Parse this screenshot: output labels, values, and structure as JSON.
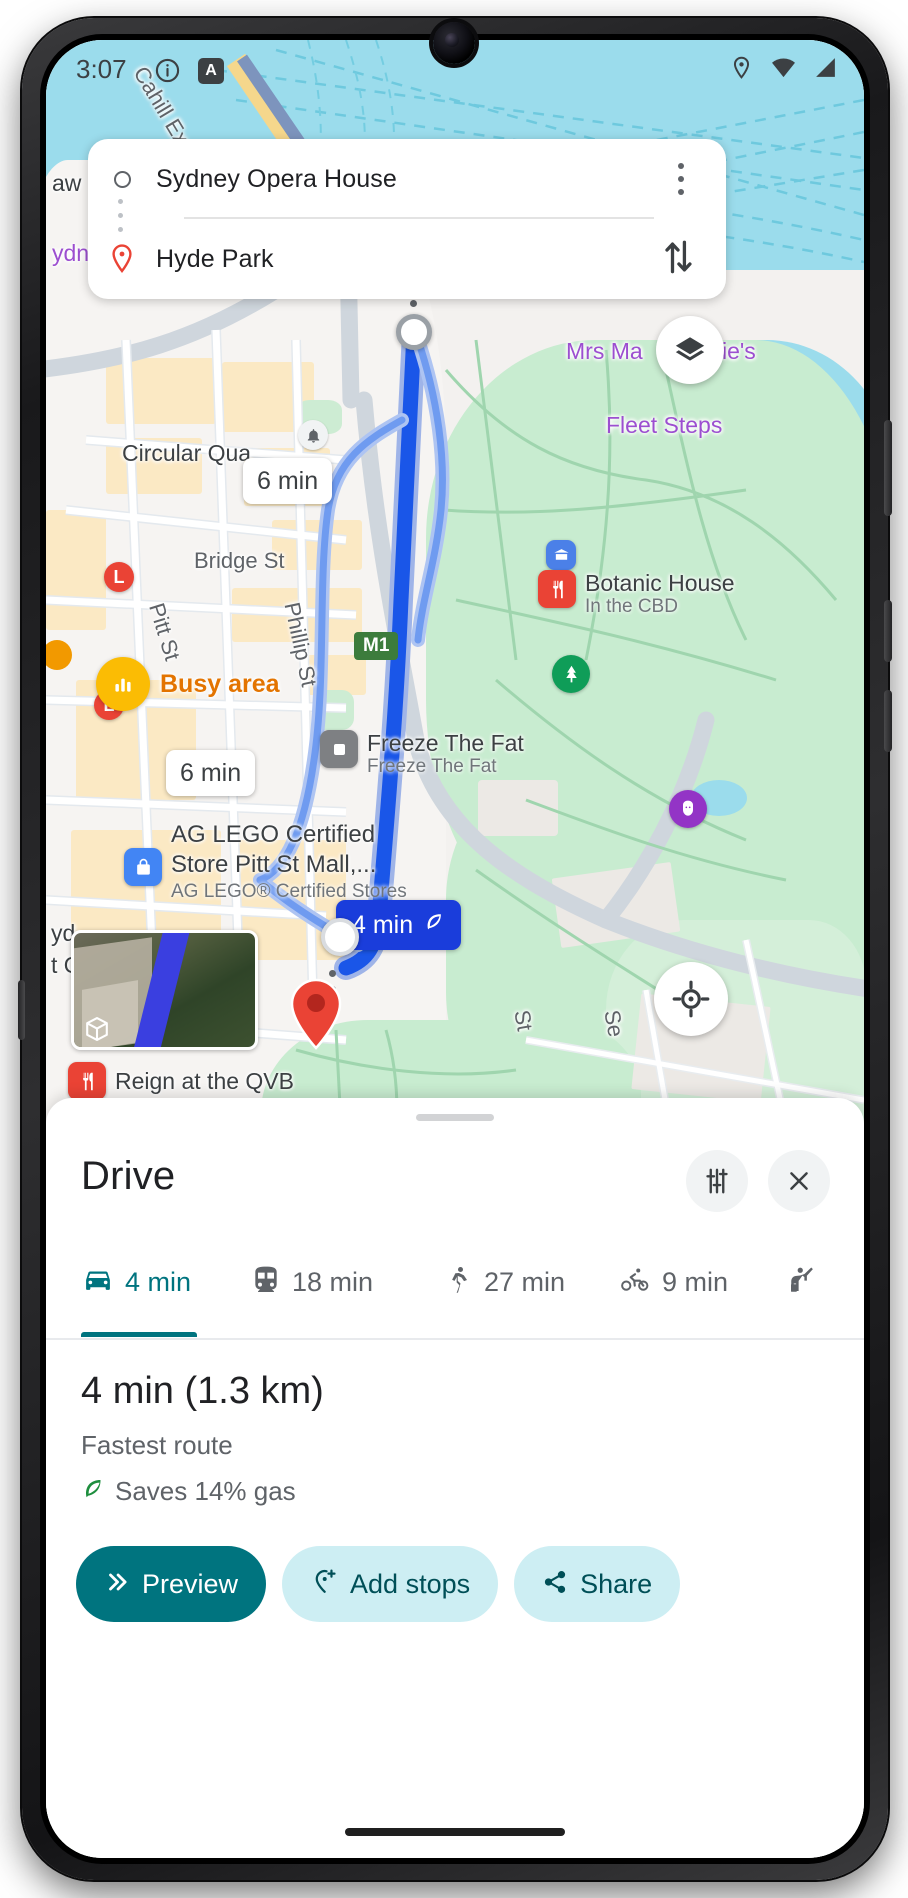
{
  "status_bar": {
    "time": "3:07",
    "info_icon": "info-circle-icon",
    "a_badge": "A",
    "location_icon": "location-pin-icon",
    "wifi_icon": "wifi-icon",
    "signal_icon": "cellular-signal-icon"
  },
  "search_card": {
    "origin": "Sydney Opera House",
    "origin_icon": "origin-circle-icon",
    "destination": "Hyde Park",
    "destination_icon": "destination-pin-icon",
    "kebab_icon": "more-options-icon",
    "swap_icon": "swap-vertical-icon"
  },
  "map": {
    "layers_button_icon": "map-layers-icon",
    "locate_button_icon": "my-location-icon",
    "thumbnail_3d_icon": "cube-3d-icon",
    "busy_area": {
      "label": "Busy area",
      "icon": "busy-bars-icon",
      "color": "#fbbc04",
      "text_color": "#e37400"
    },
    "route_badges": [
      {
        "id": "alt-1",
        "label": "6 min",
        "style": "alternate"
      },
      {
        "id": "alt-2",
        "label": "6 min",
        "style": "alternate"
      },
      {
        "id": "main",
        "label": "4 min",
        "style": "primary",
        "eco_icon": "eco-leaf-icon",
        "color": "#1a3ddb"
      }
    ],
    "labels": [
      {
        "text": "Cahill Ex",
        "kind": "road"
      },
      {
        "text": "aw",
        "kind": "plain"
      },
      {
        "text": "ydn",
        "kind": "purple"
      },
      {
        "text": "Mrs Ma",
        "kind": "purple"
      },
      {
        "text": "ie's",
        "kind": "purple"
      },
      {
        "text": "Fleet Steps",
        "kind": "purple"
      },
      {
        "text": "Circular Qua",
        "kind": "plain"
      },
      {
        "text": "Bridge St",
        "kind": "road"
      },
      {
        "text": "Pitt St",
        "kind": "road"
      },
      {
        "text": "Phillip St",
        "kind": "road"
      },
      {
        "text": "M1",
        "kind": "shield"
      },
      {
        "text": "yd",
        "kind": "plain"
      },
      {
        "text": "t Ol",
        "kind": "plain"
      },
      {
        "text": "St",
        "kind": "road"
      },
      {
        "text": "Se",
        "kind": "road"
      }
    ],
    "pois": [
      {
        "name": "Botanic House",
        "subtitle": "In the CBD",
        "icon": "restaurant-icon",
        "color": "#ea4335"
      },
      {
        "name": "Freeze The Fat",
        "subtitle": "Freeze The Fat",
        "icon": "generic-place-icon",
        "color": "#7e8083"
      },
      {
        "name": "AG LEGO Certified Store Pitt St Mall,...",
        "subtitle": "AG LEGO® Certified Stores",
        "icon": "store-icon",
        "color": "#4285f4"
      },
      {
        "name": "Reign at the QVB",
        "subtitle": "",
        "icon": "restaurant-icon",
        "color": "#ea4335"
      }
    ],
    "transit_markers": [
      "L",
      "L"
    ],
    "park_icon_markers": [
      "park-tree-icon",
      "theater-masks-icon",
      "museum-icon",
      "ferry-icon"
    ]
  },
  "sheet": {
    "title": "Drive",
    "options_icon": "route-options-icon",
    "close_icon": "close-icon",
    "grabber": "sheet-drag-handle",
    "tabs": [
      {
        "id": "drive",
        "label": "4 min",
        "icon": "car-icon",
        "active": true
      },
      {
        "id": "transit",
        "label": "18 min",
        "icon": "train-icon",
        "active": false
      },
      {
        "id": "walk",
        "label": "27 min",
        "icon": "walk-icon",
        "active": false
      },
      {
        "id": "bike",
        "label": "9 min",
        "icon": "bicycle-icon",
        "active": false
      },
      {
        "id": "rideshare",
        "label": "",
        "icon": "rideshare-hail-icon",
        "active": false
      }
    ],
    "active_tab_color": "#00747f",
    "route": {
      "summary": "4 min (1.3 km)",
      "description": "Fastest route",
      "eco_text": "Saves 14% gas",
      "eco_icon": "eco-leaf-icon",
      "eco_color": "#1e8e3e"
    },
    "actions": [
      {
        "id": "preview",
        "label": "Preview",
        "icon": "chevrons-right-icon",
        "style": "primary"
      },
      {
        "id": "add-stops",
        "label": "Add stops",
        "icon": "add-stop-pin-icon",
        "style": "secondary"
      },
      {
        "id": "share",
        "label": "Share",
        "icon": "share-icon",
        "style": "secondary"
      }
    ]
  },
  "nav_bar": "home-gesture-bar"
}
